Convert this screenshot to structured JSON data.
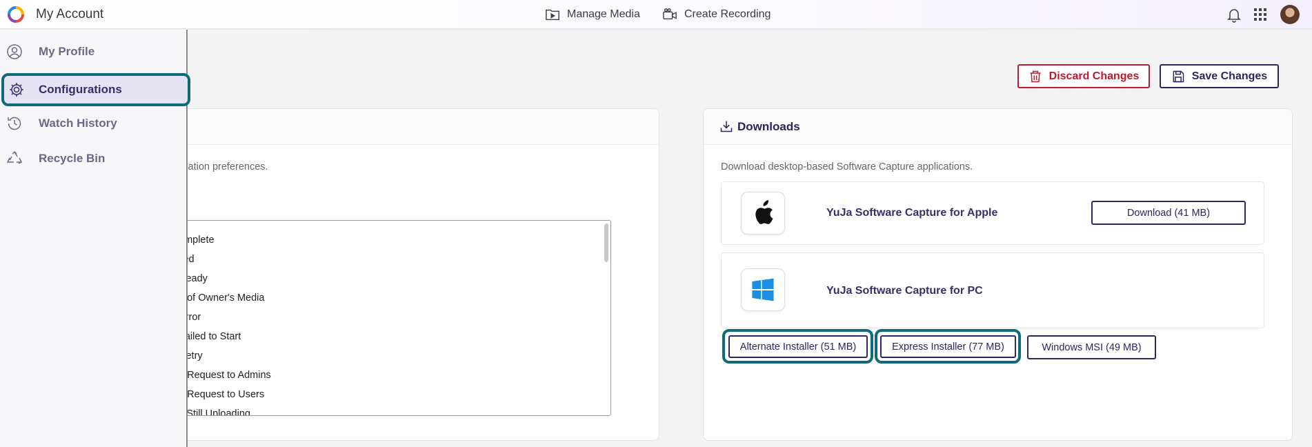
{
  "header": {
    "title": "My Account",
    "nav": [
      {
        "label": "Manage Media",
        "icon": "play-folder-icon"
      },
      {
        "label": "Create Recording",
        "icon": "video-camera-icon"
      }
    ]
  },
  "sidebar": {
    "items": [
      {
        "label": "My Profile",
        "icon": "user-circle-icon"
      },
      {
        "label": "Configurations",
        "icon": "gear-icon",
        "active": true
      },
      {
        "label": "Watch History",
        "icon": "history-icon"
      },
      {
        "label": "Recycle Bin",
        "icon": "recycle-icon"
      }
    ]
  },
  "actions": {
    "discard_label": "Discard Changes",
    "save_label": "Save Changes"
  },
  "notifications": {
    "description": "fication preferences.",
    "options": [
      "omplete",
      "iled",
      "Ready",
      "n of Owner's Media",
      "Error",
      "Failed to Start",
      "Retry",
      "n Request to Admins",
      "n Request to Users",
      "s Still Uploading"
    ]
  },
  "downloads": {
    "title": "Downloads",
    "description": "Download desktop-based Software Capture applications.",
    "apple": {
      "name": "YuJa Software Capture for Apple",
      "button": "Download (41 MB)"
    },
    "pc": {
      "name": "YuJa Software Capture for PC",
      "buttons": [
        "Alternate Installer (51 MB)",
        "Express Installer (77 MB)",
        "Windows MSI (49 MB)"
      ]
    }
  },
  "colors": {
    "accent": "#2e2560",
    "danger": "#c0182f",
    "highlight": "#0f6a7a"
  }
}
